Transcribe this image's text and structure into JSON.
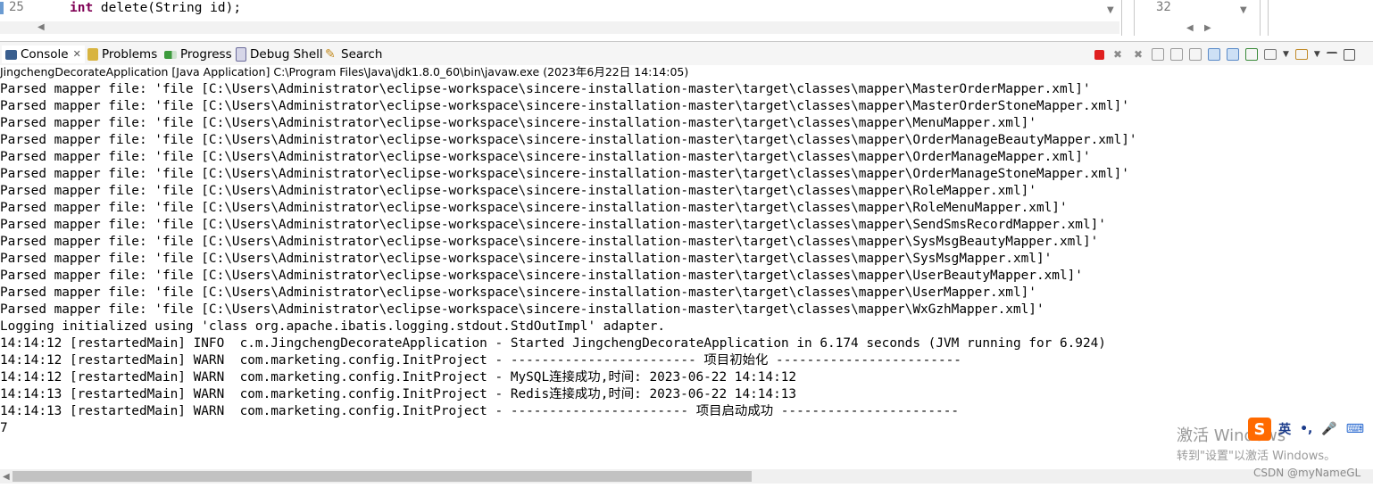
{
  "editor": {
    "line_number": "25",
    "code_keyword": "int",
    "code_rest": " delete(String id);",
    "side_line_number": "32"
  },
  "tabs": [
    {
      "label": "Console",
      "icon": "console-icon",
      "active": true
    },
    {
      "label": "Problems",
      "icon": "problems-icon"
    },
    {
      "label": "Progress",
      "icon": "progress-icon"
    },
    {
      "label": "Debug Shell",
      "icon": "debug-shell-icon"
    },
    {
      "label": "Search",
      "icon": "search-icon"
    }
  ],
  "launch_description": "JingchengDecorateApplication [Java Application] C:\\Program Files\\Java\\jdk1.8.0_60\\bin\\javaw.exe  (2023年6月22日 14:14:05)",
  "console_lines": [
    "Parsed mapper file: 'file [C:\\Users\\Administrator\\eclipse-workspace\\sincere-installation-master\\target\\classes\\mapper\\MasterOrderMapper.xml]'",
    "Parsed mapper file: 'file [C:\\Users\\Administrator\\eclipse-workspace\\sincere-installation-master\\target\\classes\\mapper\\MasterOrderStoneMapper.xml]'",
    "Parsed mapper file: 'file [C:\\Users\\Administrator\\eclipse-workspace\\sincere-installation-master\\target\\classes\\mapper\\MenuMapper.xml]'",
    "Parsed mapper file: 'file [C:\\Users\\Administrator\\eclipse-workspace\\sincere-installation-master\\target\\classes\\mapper\\OrderManageBeautyMapper.xml]'",
    "Parsed mapper file: 'file [C:\\Users\\Administrator\\eclipse-workspace\\sincere-installation-master\\target\\classes\\mapper\\OrderManageMapper.xml]'",
    "Parsed mapper file: 'file [C:\\Users\\Administrator\\eclipse-workspace\\sincere-installation-master\\target\\classes\\mapper\\OrderManageStoneMapper.xml]'",
    "Parsed mapper file: 'file [C:\\Users\\Administrator\\eclipse-workspace\\sincere-installation-master\\target\\classes\\mapper\\RoleMapper.xml]'",
    "Parsed mapper file: 'file [C:\\Users\\Administrator\\eclipse-workspace\\sincere-installation-master\\target\\classes\\mapper\\RoleMenuMapper.xml]'",
    "Parsed mapper file: 'file [C:\\Users\\Administrator\\eclipse-workspace\\sincere-installation-master\\target\\classes\\mapper\\SendSmsRecordMapper.xml]'",
    "Parsed mapper file: 'file [C:\\Users\\Administrator\\eclipse-workspace\\sincere-installation-master\\target\\classes\\mapper\\SysMsgBeautyMapper.xml]'",
    "Parsed mapper file: 'file [C:\\Users\\Administrator\\eclipse-workspace\\sincere-installation-master\\target\\classes\\mapper\\SysMsgMapper.xml]'",
    "Parsed mapper file: 'file [C:\\Users\\Administrator\\eclipse-workspace\\sincere-installation-master\\target\\classes\\mapper\\UserBeautyMapper.xml]'",
    "Parsed mapper file: 'file [C:\\Users\\Administrator\\eclipse-workspace\\sincere-installation-master\\target\\classes\\mapper\\UserMapper.xml]'",
    "Parsed mapper file: 'file [C:\\Users\\Administrator\\eclipse-workspace\\sincere-installation-master\\target\\classes\\mapper\\WxGzhMapper.xml]'",
    "Logging initialized using 'class org.apache.ibatis.logging.stdout.StdOutImpl' adapter.",
    "14:14:12 [restartedMain] INFO  c.m.JingchengDecorateApplication - Started JingchengDecorateApplication in 6.174 seconds (JVM running for 6.924)",
    "14:14:12 [restartedMain] WARN  com.marketing.config.InitProject - ------------------------ 项目初始化 ------------------------",
    "14:14:12 [restartedMain] WARN  com.marketing.config.InitProject - MySQL连接成功,时间: 2023-06-22 14:14:12",
    "14:14:13 [restartedMain] WARN  com.marketing.config.InitProject - Redis连接成功,时间: 2023-06-22 14:14:13",
    "14:14:13 [restartedMain] WARN  com.marketing.config.InitProject - ----------------------- 项目启动成功 -----------------------",
    "7"
  ],
  "overlay": {
    "watermark": "激活 Windows",
    "watermark_sub": "转到\"设置\"以激活 Windows。",
    "csdn": "CSDN @myNameGL",
    "ime_lang": "英",
    "ime_punct": "•,"
  },
  "colors": {
    "terminate_red": "#e02020",
    "keyword": "#7f0055",
    "ime_orange": "#ff6a00"
  }
}
